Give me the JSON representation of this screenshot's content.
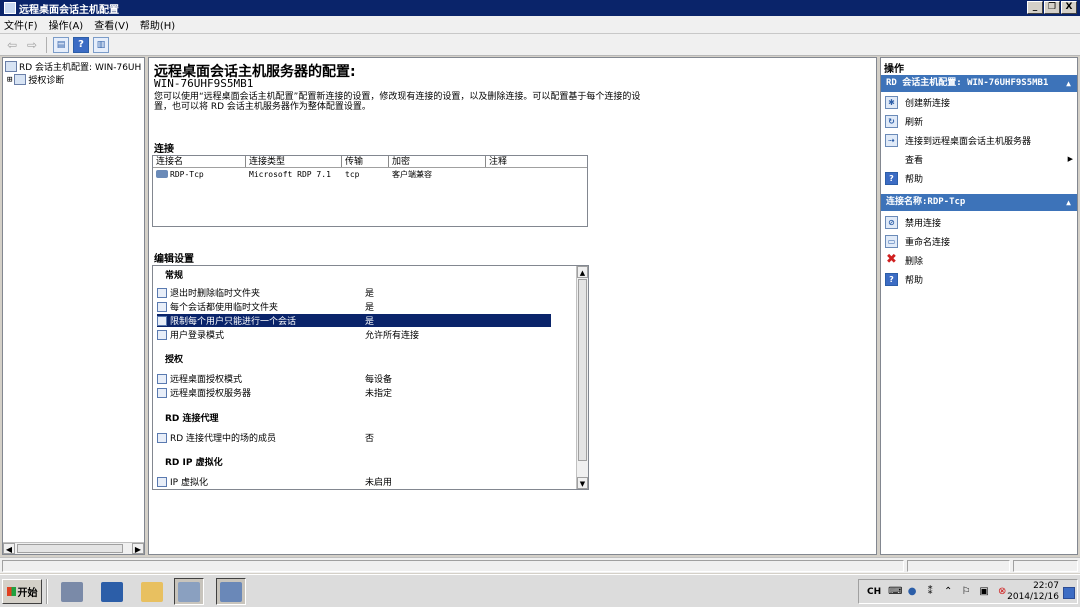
{
  "window": {
    "title": "远程桌面会话主机配置",
    "minimize": "_",
    "restore": "❐",
    "close": "X"
  },
  "menu": [
    "文件(F)",
    "操作(A)",
    "查看(V)",
    "帮助(H)"
  ],
  "toolbar": {
    "back": "⇦",
    "forward": "⇨",
    "help": "?"
  },
  "tree": {
    "root": "RD 会话主机配置: WIN-76UH",
    "child_expander": "⊞",
    "child": "授权诊断"
  },
  "scroll": {
    "left": "◀",
    "right": "▶",
    "up": "▲",
    "down": "▼"
  },
  "main": {
    "title": "远程桌面会话主机服务器的配置:",
    "server": "WIN-76UHF9S5MB1",
    "description": "您可以使用“远程桌面会话主机配置”配置新连接的设置，修改现有连接的设置，以及删除连接。可以配置基于每个连接的设置，也可以将 RD 会话主机服务器作为整体配置设置。",
    "connections_title": "连接",
    "connections": {
      "headers": [
        "连接名",
        "连接类型",
        "传输",
        "加密",
        "注释"
      ],
      "rows": [
        {
          "name": "RDP-Tcp",
          "type": "Microsoft RDP 7.1",
          "transport": "tcp",
          "encryption": "客户端兼容",
          "comment": ""
        }
      ]
    },
    "edit_title": "编辑设置",
    "settings": [
      {
        "category": "常规",
        "items": [
          {
            "label": "退出时删除临时文件夹",
            "value": "是"
          },
          {
            "label": "每个会话都使用临时文件夹",
            "value": "是"
          },
          {
            "label": "限制每个用户只能进行一个会话",
            "value": "是",
            "selected": true
          },
          {
            "label": "用户登录模式",
            "value": "允许所有连接"
          }
        ]
      },
      {
        "category": "授权",
        "items": [
          {
            "label": "远程桌面授权模式",
            "value": "每设备"
          },
          {
            "label": "远程桌面授权服务器",
            "value": "未指定"
          }
        ]
      },
      {
        "category": "RD 连接代理",
        "items": [
          {
            "label": "RD 连接代理中的场的成员",
            "value": "否"
          }
        ]
      },
      {
        "category": "RD IP 虚拟化",
        "items": [
          {
            "label": "IP 虚拟化",
            "value": "未启用"
          }
        ]
      }
    ]
  },
  "actions": {
    "title": "操作",
    "group1": {
      "header": "RD 会话主机配置: WIN-76UHF9S5MB1",
      "caret": "▲",
      "items": [
        "创建新连接",
        "刷新",
        "连接到远程桌面会话主机服务器",
        "查看",
        "帮助"
      ],
      "view_arrow": "▶"
    },
    "group2": {
      "header": "连接名称:RDP-Tcp",
      "caret": "▲",
      "items": [
        "禁用连接",
        "重命名连接",
        "删除",
        "帮助"
      ]
    }
  },
  "taskbar": {
    "start": "开始",
    "tray_lang": "CH",
    "time": "22:07",
    "date": "2014/12/16"
  }
}
